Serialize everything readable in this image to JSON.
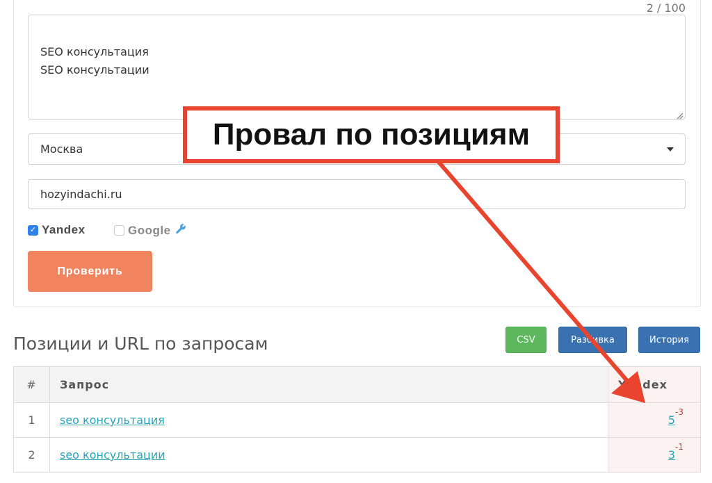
{
  "form": {
    "counter": "2 / 100",
    "queries_text": "SEO консультация\nSEO консультации",
    "region_value": "Москва",
    "site_value": "hozyindachi.ru",
    "engines": [
      {
        "label": "Yandex",
        "checked": true
      },
      {
        "label": "Google",
        "checked": false
      }
    ],
    "submit_label": "Проверить"
  },
  "results": {
    "title": "Позиции и URL по запросам",
    "buttons": {
      "csv": "CSV",
      "split": "Разбивка",
      "history": "История"
    },
    "columns": {
      "num": "#",
      "query": "Запрос",
      "yandex": "Yandex"
    },
    "rows": [
      {
        "num": "1",
        "query": "seo консультация",
        "position": "5",
        "delta": "-3"
      },
      {
        "num": "2",
        "query": "seo консультации",
        "position": "3",
        "delta": "-1"
      }
    ]
  },
  "annotation": {
    "text": "Провал по позициям"
  },
  "colors": {
    "accent_button": "#f0845e",
    "annotation_red": "#e8442e",
    "link": "#2aa3b8",
    "csv_green": "#5cb85c",
    "blue_button": "#3a71b0"
  },
  "icons": {
    "settings": "wrench-icon",
    "dropdown": "caret-down-icon"
  }
}
